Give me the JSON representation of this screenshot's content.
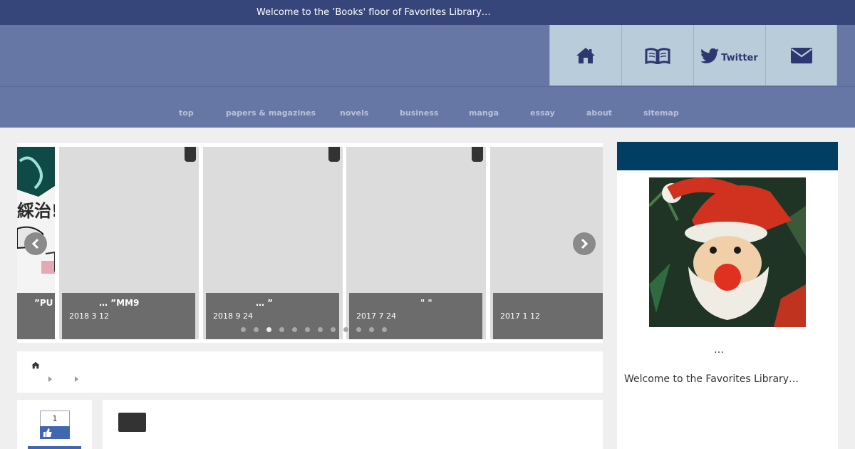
{
  "topbar": {
    "welcome": "Welcome to the ’Books' floor of Favorites Library…"
  },
  "header_nav": [
    {
      "icon": "home-icon",
      "label": ""
    },
    {
      "icon": "open-book-icon",
      "label": ""
    },
    {
      "icon": "twitter-icon",
      "label": "Twitter"
    },
    {
      "icon": "envelope-icon",
      "label": ""
    }
  ],
  "global_nav": [
    "top",
    "papers & magazines",
    "novels",
    "business",
    "manga",
    "essay",
    "about",
    "sitemap"
  ],
  "slider": {
    "slides": [
      {
        "title": "”PU",
        "date": ""
      },
      {
        "title": "…                ”MM9",
        "date": "2018  3  12"
      },
      {
        "title": "…          ”",
        "date": "2018  9  24"
      },
      {
        "title": "\"          \"",
        "date": "2017  7  24"
      },
      {
        "title": "",
        "date": "2017  1  12"
      }
    ],
    "dot_count": 12,
    "active_dot_index": 2
  },
  "social": {
    "like_count": "1"
  },
  "sidebar": {
    "heading": "",
    "ellipsis": "…",
    "welcome": "Welcome to the Favorites Library…"
  },
  "colors": {
    "topbar": "#36467a",
    "header": "#6677a6",
    "nav_tile": "#b9ccd9",
    "sidebar_head": "#003f63",
    "caption": "#6c6c6c"
  }
}
